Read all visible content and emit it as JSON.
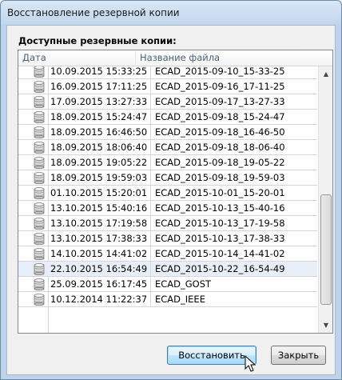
{
  "window": {
    "title": "Восстановление резервной копии"
  },
  "group_label": "Доступные резервные копии:",
  "columns": {
    "date": "Дата",
    "name": "Название файла"
  },
  "rows": [
    {
      "date": "10.09.2015 15:33:25",
      "name": "ECAD_2015-09-10_15-33-25"
    },
    {
      "date": "16.09.2015 17:11:25",
      "name": "ECAD_2015-09-16_17-11-25"
    },
    {
      "date": "17.09.2015 13:27:33",
      "name": "ECAD_2015-09-17_13-27-33"
    },
    {
      "date": "18.09.2015 15:24:47",
      "name": "ECAD_2015-09-18_15-24-47"
    },
    {
      "date": "18.09.2015 16:46:50",
      "name": "ECAD_2015-09-18_16-46-50"
    },
    {
      "date": "18.09.2015 18:06:40",
      "name": "ECAD_2015-09-18_18-06-40"
    },
    {
      "date": "18.09.2015 19:05:22",
      "name": "ECAD_2015-09-18_19-05-22"
    },
    {
      "date": "18.09.2015 19:59:03",
      "name": "ECAD_2015-09-18_19-59-03"
    },
    {
      "date": "01.10.2015 15:20:01",
      "name": "ECAD_2015-10-01_15-20-01"
    },
    {
      "date": "13.10.2015 15:40:16",
      "name": "ECAD_2015-10-13_15-40-16"
    },
    {
      "date": "13.10.2015 17:19:58",
      "name": "ECAD_2015-10-13_17-19-58"
    },
    {
      "date": "13.10.2015 17:38:33",
      "name": "ECAD_2015-10-13_17-38-33"
    },
    {
      "date": "14.10.2015 14:41:02",
      "name": "ECAD_2015-10-14_14-41-02"
    },
    {
      "date": "22.10.2015 16:54:49",
      "name": "ECAD_2015-10-22_16-54-49",
      "selected": true
    },
    {
      "date": "25.09.2015 16:17:45",
      "name": "ECAD_GOST"
    },
    {
      "date": "10.12.2014 11:22:37",
      "name": "ECAD_IEEE"
    }
  ],
  "buttons": {
    "restore": "Восстановить",
    "close": "Закрыть"
  },
  "colors": {
    "selection": "#e8eef8",
    "header_text": "#4c607a",
    "primary_button": "#bee6fd"
  },
  "icons": {
    "row_icon": "database-icon",
    "scroll_up": "chevron-up-icon",
    "scroll_down": "chevron-down-icon"
  }
}
